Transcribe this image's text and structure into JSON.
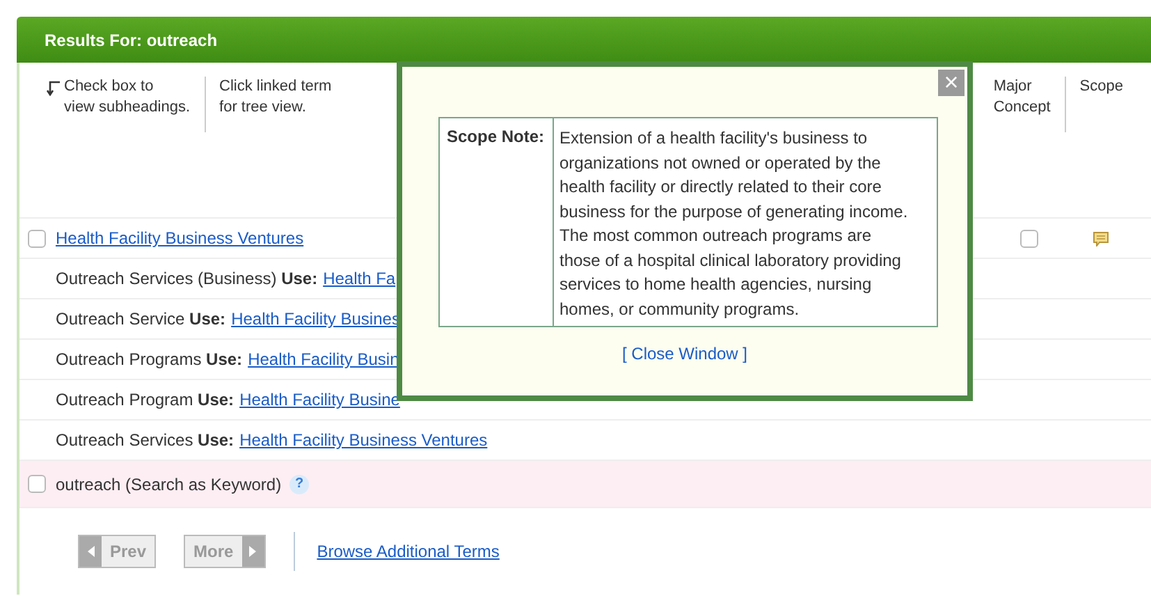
{
  "header": {
    "title": "Results For: outreach"
  },
  "instructions": [
    {
      "text": "Check box to\nview subheadings.",
      "arrow": true
    },
    {
      "text": "Click linked term\nfor tree view.",
      "arrow": false
    }
  ],
  "columns": [
    "Major\nConcept",
    "Scope"
  ],
  "rows": [
    {
      "kind": "term",
      "checked": false,
      "link": "Health Facility Business Ventures",
      "major_checked": false,
      "has_scope": true
    },
    {
      "kind": "use",
      "term": "Outreach Services (Business) **Use:**",
      "link": "Health Fa"
    },
    {
      "kind": "use",
      "term": "Outreach Service **Use:**",
      "link": "Health Facility Busines"
    },
    {
      "kind": "use",
      "term": "Outreach Programs **Use:**",
      "link": "Health Facility Busin"
    },
    {
      "kind": "use",
      "term": "Outreach Program **Use:**",
      "link": "Health Facility Busine"
    },
    {
      "kind": "use",
      "term": "Outreach Services **Use:**",
      "link": "Health Facility Business Ventures"
    }
  ],
  "keyword": {
    "checked": false,
    "text": "outreach (Search as Keyword)",
    "help": "?"
  },
  "pager": [
    {
      "label": "Prev",
      "disabled": true
    },
    {
      "label": "More",
      "disabled": true
    }
  ],
  "browse_link": "Browse Additional Terms",
  "popup": {
    "close": "×",
    "label": "Scope Note:",
    "text": "Extension of a health facility's business to organizations not owned or operated by the health facility or directly related to their core business for the purpose of generating income. The most common outreach programs are those of a hospital clinical laboratory providing services to home health agencies, nursing homes, or community programs.",
    "close_link": "[ Close Window ]"
  }
}
